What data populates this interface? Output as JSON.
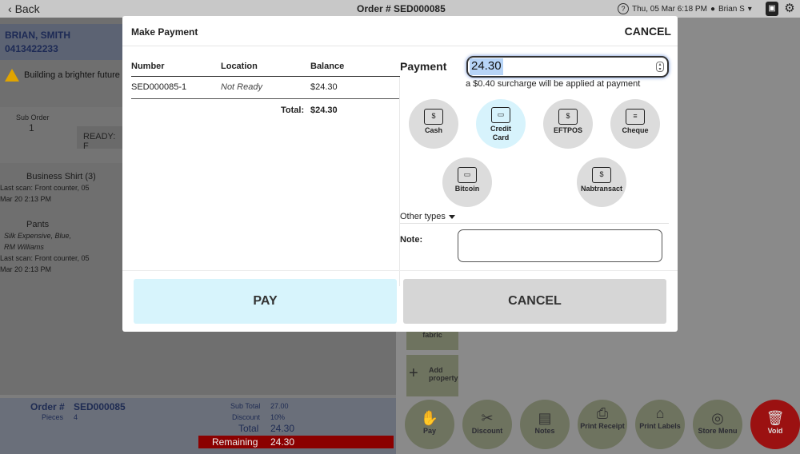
{
  "topbar": {
    "back_label": "Back",
    "order_title": "Order # SED000085",
    "datetime": "Thu, 05 Mar 6:18 PM",
    "user": "Brian S"
  },
  "background": {
    "customer_name": "BRIAN, SMITH",
    "customer_phone": "0413422233",
    "alert_text": "Building a brighter future",
    "sub_order_label": "Sub Order",
    "sub_order_number": "1",
    "ready_label": "READY: F",
    "items": [
      {
        "name": "Business Shirt (3)",
        "details": [
          "Last scan: Front counter, 05",
          "Mar 20 2:13 PM"
        ]
      },
      {
        "name": "Pants",
        "details": [
          "Silk Expensive, Blue,",
          "RM Williams",
          "Last scan: Front counter, 05",
          "Mar 20 2:13 PM"
        ]
      }
    ],
    "side_tiles": [
      {
        "label": "fabric"
      },
      {
        "label": "Add property"
      }
    ],
    "summary": {
      "order_label": "Order #",
      "order_value": "SED000085",
      "pieces_label": "Pieces",
      "pieces_value": "4",
      "sub_total_label": "Sub Total",
      "sub_total_value": "27.00",
      "discount_label": "Discount",
      "discount_value": "10%",
      "total_label": "Total",
      "total_value": "24.30",
      "remaining_label": "Remaining",
      "remaining_value": "24.30"
    },
    "actions": [
      {
        "label": "Pay",
        "icon": "hand-coin-icon"
      },
      {
        "label": "Discount",
        "icon": "scissors-icon"
      },
      {
        "label": "Notes",
        "icon": "document-icon"
      },
      {
        "label": "Print Receipt",
        "icon": "printer-icon"
      },
      {
        "label": "Print Labels",
        "icon": "tag-icon"
      },
      {
        "label": "Store Menu",
        "icon": "washer-icon"
      },
      {
        "label": "Void",
        "icon": "trash-icon"
      }
    ]
  },
  "modal": {
    "title": "Make Payment",
    "cancel_top": "CANCEL",
    "table": {
      "headers": [
        "Number",
        "Location",
        "Balance"
      ],
      "rows": [
        {
          "number": "SED000085-1",
          "location": "Not Ready",
          "balance": "$24.30"
        }
      ],
      "total_label": "Total:",
      "total_value": "$24.30"
    },
    "payment_label": "Payment",
    "payment_value": "24.30",
    "surcharge_note": "a $0.40 surcharge will be applied at payment",
    "methods": [
      {
        "label": "Cash",
        "icon": "cash-icon",
        "selected": false
      },
      {
        "label": "Credit Card",
        "icon": "credit-card-icon",
        "selected": true
      },
      {
        "label": "EFTPOS",
        "icon": "eftpos-icon",
        "selected": false
      },
      {
        "label": "Cheque",
        "icon": "cheque-icon",
        "selected": false
      },
      {
        "label": "Bitcoin",
        "icon": "bitcoin-icon",
        "selected": false
      },
      {
        "label": "Nabtransact",
        "icon": "nabtransact-icon",
        "selected": false
      }
    ],
    "other_types_label": "Other types",
    "note_label": "Note:",
    "note_value": "",
    "pay_button": "PAY",
    "cancel_button": "CANCEL",
    "colors": {
      "selected_method": "#d7f3fc",
      "pay_button_bg": "#d7f4fc",
      "cancel_button_bg": "#d6d6d6",
      "remaining_bg": "#8b0000",
      "void_bg": "#9b1111"
    }
  }
}
